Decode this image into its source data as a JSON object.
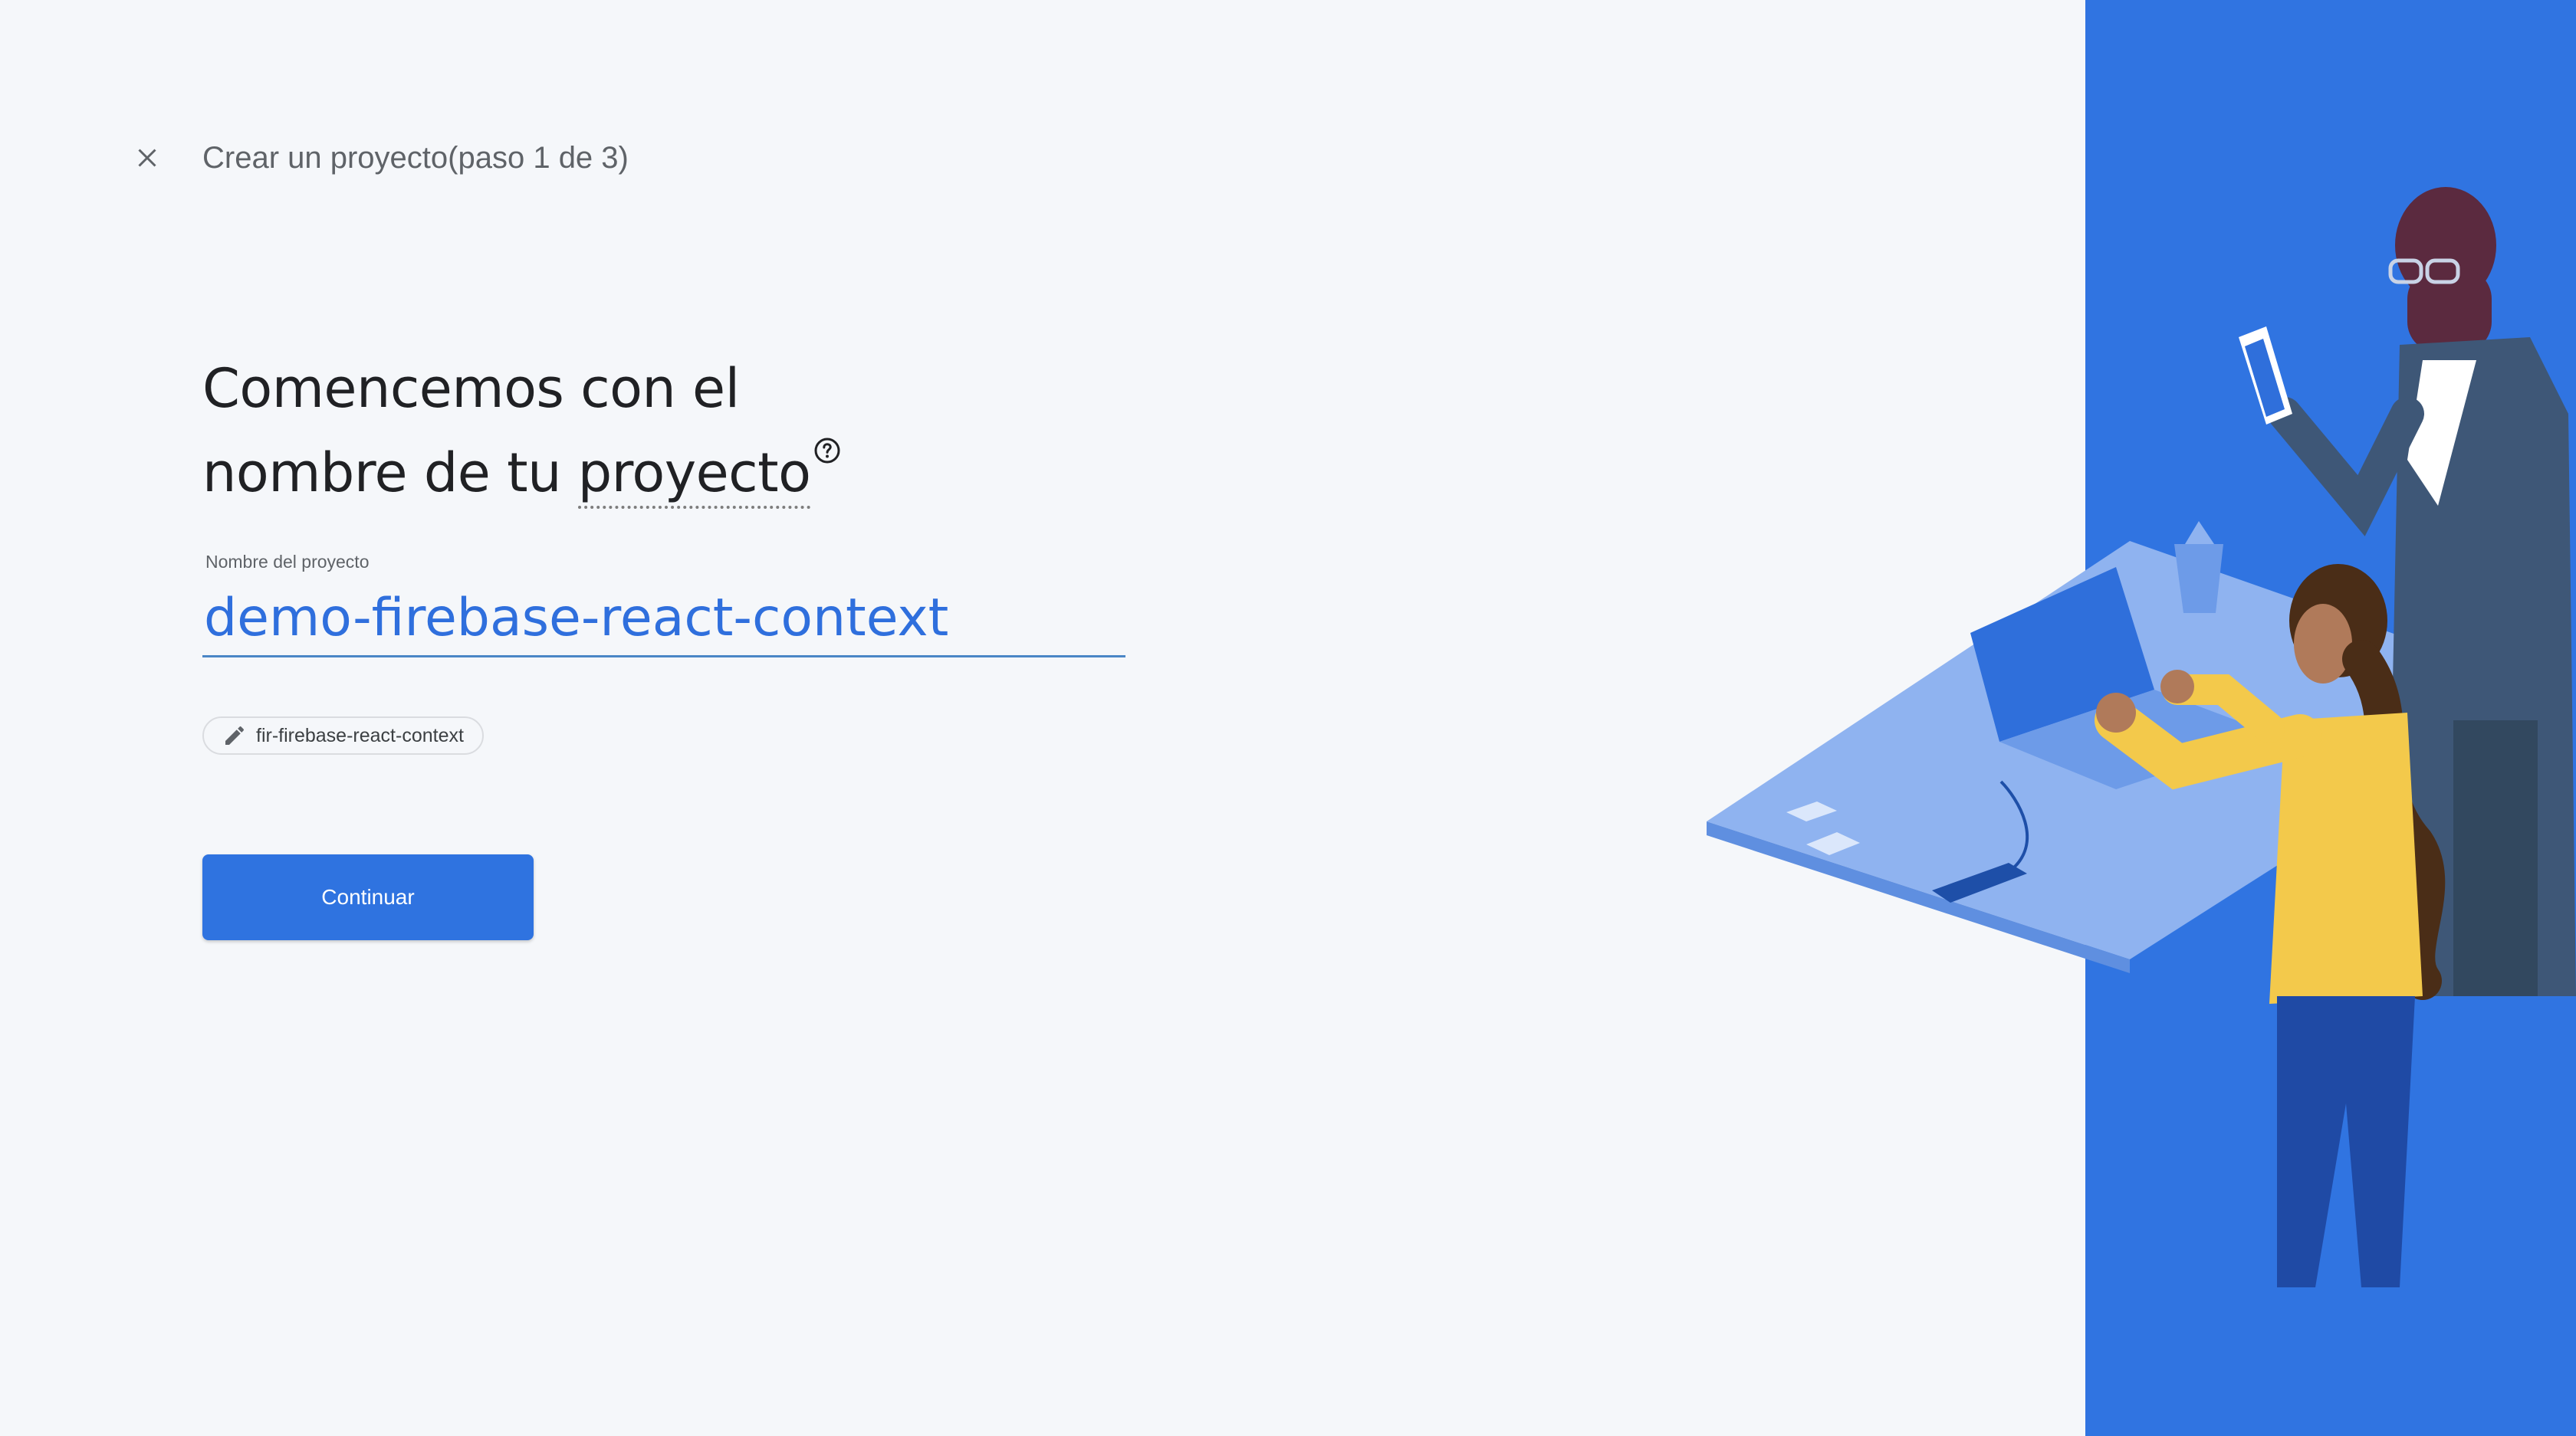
{
  "header": {
    "close_icon": "close-icon",
    "step_title": "Crear un proyecto(paso 1 de 3)"
  },
  "main": {
    "heading_line1": "Comencemos con el",
    "heading_line2_prefix": "nombre de tu ",
    "heading_term": "proyecto",
    "help_icon": "help-circle-icon",
    "field_label": "Nombre del proyecto",
    "project_name_value": "demo-firebase-react-context",
    "project_id_chip": {
      "icon": "pencil-icon",
      "label": "fir-firebase-react-context"
    },
    "continue_label": "Continuar"
  },
  "colors": {
    "background": "#f5f7fa",
    "accent": "#2f73e0",
    "panel": "#3074e1",
    "input_text": "#2f6fdd"
  }
}
